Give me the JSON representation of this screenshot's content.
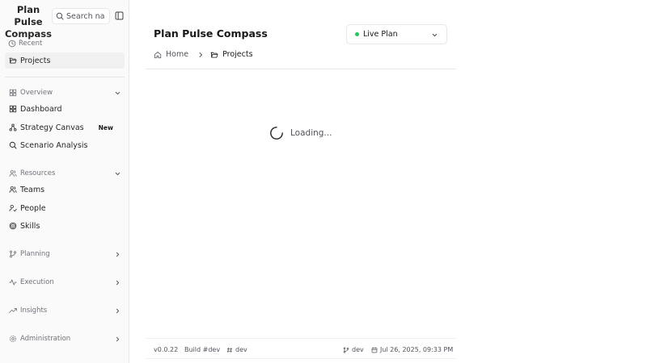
{
  "app": {
    "title": "Plan Pulse Compass"
  },
  "sidebar": {
    "search_placeholder": "Search na",
    "recent_label": "Recent",
    "recent_items": [
      {
        "label": "Projects"
      }
    ],
    "overview": {
      "label": "Overview",
      "items": [
        {
          "label": "Dashboard"
        },
        {
          "label": "Strategy Canvas",
          "badge": "New"
        },
        {
          "label": "Scenario Analysis"
        }
      ]
    },
    "resources": {
      "label": "Resources",
      "items": [
        {
          "label": "Teams"
        },
        {
          "label": "People"
        },
        {
          "label": "Skills"
        }
      ]
    },
    "groups": [
      {
        "label": "Planning"
      },
      {
        "label": "Execution"
      },
      {
        "label": "Insights"
      },
      {
        "label": "Administration"
      }
    ]
  },
  "main": {
    "title": "Plan Pulse Compass",
    "plan_select": {
      "value": "Live Plan",
      "status_color": "#22c55e"
    },
    "breadcrumb": [
      {
        "label": "Home"
      },
      {
        "label": "Projects"
      }
    ],
    "loading_text": "Loading..."
  },
  "footer": {
    "version": "v0.0.22",
    "build": "Build #dev",
    "hash": "dev",
    "branch": "dev",
    "timestamp": "Jul 26, 2025, 09:33 PM"
  }
}
